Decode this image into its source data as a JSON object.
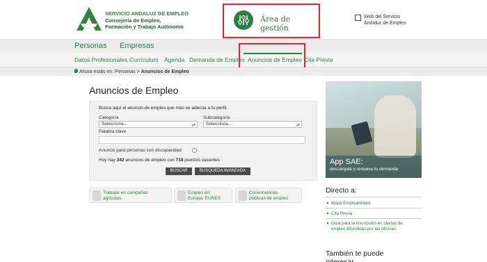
{
  "header": {
    "org_line1": "SERVICIO ANDALUZ DE EMPLEO",
    "org_line2": "Consejería de Empleo,",
    "org_line3": "Formación y Trabajo Autónomo",
    "area_label": "Área de gestión",
    "web_link_line1": "Web del Servicio",
    "web_link_line2": "Andaluz de Empleo"
  },
  "nav_primary": [
    "Personas",
    "Empresas"
  ],
  "nav_secondary": [
    "Datos Profesionales",
    "Currículum",
    "Agenda",
    "Demanda de Empleo",
    "Anuncios de Empleo",
    "Cita Previa"
  ],
  "breadcrumb": {
    "prefix": "Ahora estás en:",
    "parent": "Personas",
    "separator": ">",
    "current": "Anuncios de Empleo"
  },
  "main": {
    "title": "Anuncios de Empleo",
    "intro": "Busca aquí el anuncio de empleo que más se adecúa a tu perfil.",
    "category_label": "Categoría",
    "category_value": "Selecciona...",
    "subcategory_label": "Subcategoría",
    "subcategory_value": "Selecciona...",
    "keyword_label": "Palabra clave",
    "keyword_value": "",
    "disability_label": "Anuncio para personas con discapacidad",
    "count_prefix": "Hoy hay",
    "count_ads": "342",
    "count_middle": "anuncios de empleo con",
    "count_vacancies": "718",
    "count_suffix": "puestos vacantes",
    "search_button": "BUSCAR",
    "advanced_button": "BÚSQUEDA AVANZADA"
  },
  "quick_links": [
    {
      "line1": "Trabajar en campañas",
      "line2": "agrícolas",
      "icon": "drop-icon"
    },
    {
      "line1": "Empleo en",
      "line2": "Europa: EURES",
      "icon": "eu-flag-icon"
    },
    {
      "line1": "Convocatorias",
      "line2": "públicas de empleo",
      "icon": "people-icon"
    }
  ],
  "sidebar": {
    "promo_title": "App SAE:",
    "promo_subtitle": "descargala y renueva tu demanda",
    "directo_title": "Directo a:",
    "directo_links": [
      "Mapa Empleabilidad",
      "Cita Previa",
      "Guía para la inscripción en ofertas de empleo difundidas por las oficinas"
    ],
    "also_title_line1": "También te puede",
    "also_title_line2": "interesar"
  },
  "colors": {
    "brand_green": "#2e7d42",
    "highlight_red": "#e52329",
    "button_dark": "#4b4b4b"
  }
}
